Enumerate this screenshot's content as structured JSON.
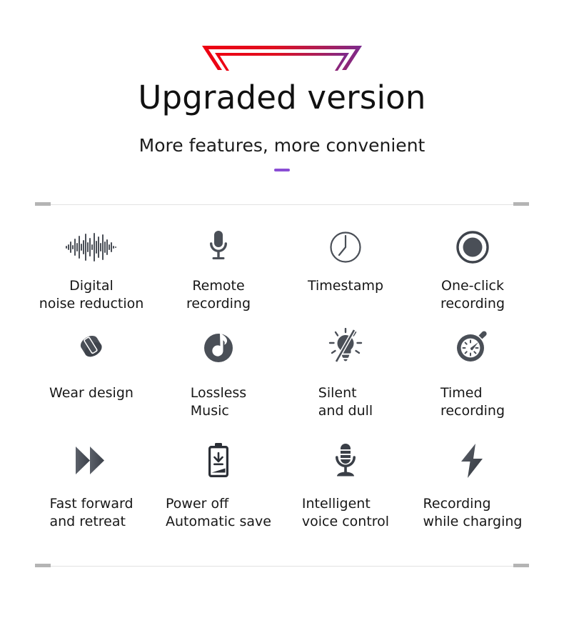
{
  "header": {
    "banner_icon": "double-chevron-banner-icon",
    "banner_gradient_start": "#ee0011",
    "banner_gradient_end": "#7a2b8e",
    "title": "Upgraded version",
    "subtitle": "More features, more convenient",
    "underline_color": "#8a4dd4"
  },
  "divider": {
    "cap_color": "#b4b4b4",
    "line_color": "#e2e2e2"
  },
  "features": {
    "icon_color": "#4a4f57",
    "rows": [
      {
        "align": "center",
        "items": [
          {
            "icon": "audio-waveform-icon",
            "label": "Digital\nnoise reduction"
          },
          {
            "icon": "microphone-icon",
            "label": "Remote\nrecording"
          },
          {
            "icon": "clock-icon",
            "label": "Timestamp"
          },
          {
            "icon": "record-button-icon",
            "label": "One-click\nrecording"
          }
        ]
      },
      {
        "align": "left",
        "items": [
          {
            "icon": "wristband-icon",
            "label": "Wear design"
          },
          {
            "icon": "music-note-circle-icon",
            "label": "Lossless\nMusic"
          },
          {
            "icon": "lightbulb-off-icon",
            "label": "Silent\nand dull"
          },
          {
            "icon": "stopwatch-icon",
            "label": "Timed\nrecording"
          }
        ]
      },
      {
        "align": "left",
        "items": [
          {
            "icon": "fast-forward-icon",
            "label": "Fast forward\nand retreat"
          },
          {
            "icon": "battery-save-icon",
            "label": "Power off\nAutomatic save"
          },
          {
            "icon": "studio-microphone-icon",
            "label": "Intelligent\nvoice control"
          },
          {
            "icon": "lightning-bolt-icon",
            "label": "Recording\nwhile charging"
          }
        ]
      }
    ]
  }
}
